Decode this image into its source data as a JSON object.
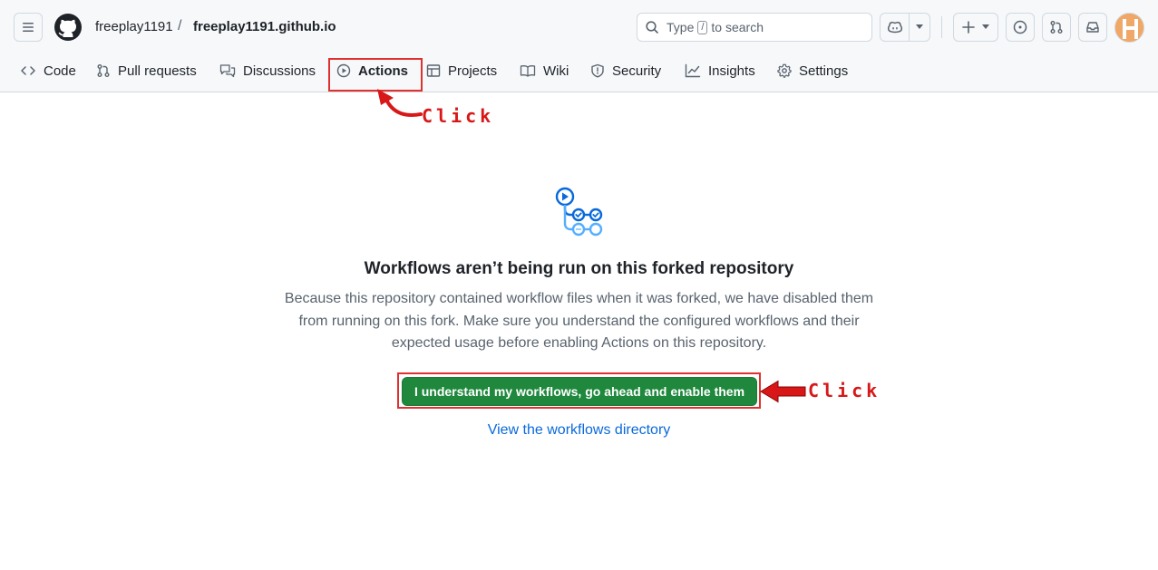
{
  "header": {
    "owner": "freeplay1191",
    "separator": "/",
    "repo": "freeplay1191.github.io",
    "search": {
      "prefix": "Type",
      "key": "/",
      "suffix": "to search"
    }
  },
  "tabs": [
    {
      "label": "Code",
      "icon": "code-icon"
    },
    {
      "label": "Pull requests",
      "icon": "git-pull-request-icon"
    },
    {
      "label": "Discussions",
      "icon": "comment-discussion-icon"
    },
    {
      "label": "Actions",
      "icon": "play-icon",
      "active": true
    },
    {
      "label": "Projects",
      "icon": "table-icon"
    },
    {
      "label": "Wiki",
      "icon": "book-icon"
    },
    {
      "label": "Security",
      "icon": "shield-icon"
    },
    {
      "label": "Insights",
      "icon": "graph-icon"
    },
    {
      "label": "Settings",
      "icon": "gear-icon"
    }
  ],
  "annotations": {
    "click_top": "Click",
    "click_button": "Click",
    "color": "#d81818"
  },
  "blankslate": {
    "title": "Workflows aren’t being run on this forked repository",
    "description": "Because this repository contained workflow files when it was forked, we have disabled them from running on this fork. Make sure you understand the configured workflows and their expected usage before enabling Actions on this repository.",
    "enable_button": "I understand my workflows, go ahead and enable them",
    "workflows_link": "View the workflows directory"
  },
  "colors": {
    "accent": "#0969da",
    "primary_button": "#1f883d",
    "highlight": "#e03131"
  }
}
